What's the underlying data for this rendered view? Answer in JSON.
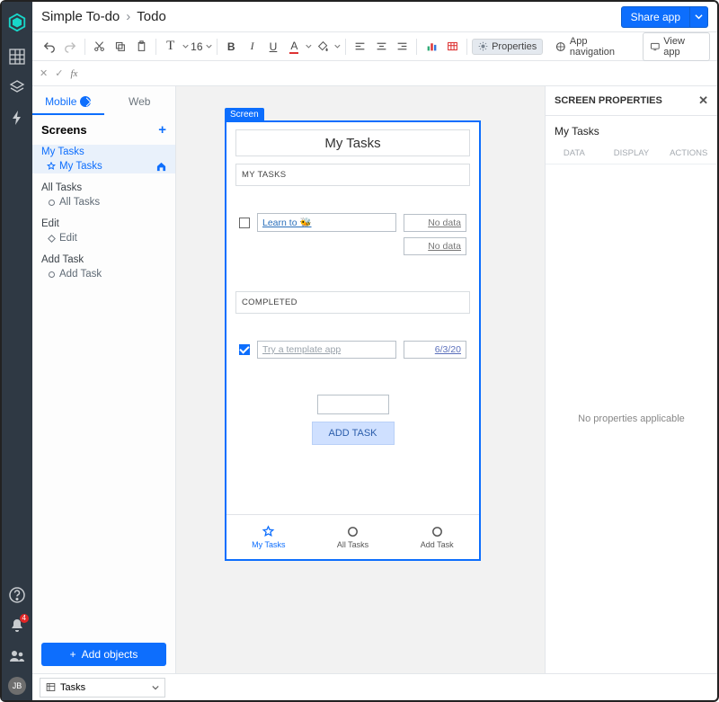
{
  "breadcrumb": {
    "app": "Simple To-do",
    "page": "Todo"
  },
  "topbar": {
    "share": "Share app"
  },
  "toolbar": {
    "font_size": "16",
    "properties": "Properties",
    "app_navigation": "App navigation",
    "view_app": "View app"
  },
  "fx": {
    "label": "fx"
  },
  "sidebar": {
    "tabs": {
      "mobile": "Mobile",
      "web": "Web"
    },
    "heading": "Screens",
    "groups": [
      {
        "title": "My Tasks",
        "sub": "My Tasks",
        "icon": "star",
        "selected": true,
        "home": true
      },
      {
        "title": "All Tasks",
        "sub": "All Tasks",
        "icon": "circle"
      },
      {
        "title": "Edit",
        "sub": "Edit",
        "icon": "tag"
      },
      {
        "title": "Add Task",
        "sub": "Add Task",
        "icon": "circle"
      }
    ],
    "add_objects": "Add objects"
  },
  "canvas": {
    "screen_tag": "Screen",
    "title": "My Tasks",
    "sections": {
      "my_tasks_label": "MY TASKS",
      "completed_label": "COMPLETED"
    },
    "tasks": {
      "open": {
        "text": "Learn to 🐝",
        "right1": "No data",
        "right2": "No data"
      },
      "done": {
        "text": "Try a template app",
        "right": "6/3/20"
      }
    },
    "add_task_btn": "ADD TASK",
    "nav": {
      "my": "My Tasks",
      "all": "All Tasks",
      "add": "Add Task"
    }
  },
  "right_panel": {
    "header": "SCREEN PROPERTIES",
    "title": "My Tasks",
    "tabs": {
      "data": "DATA",
      "display": "DISPLAY",
      "actions": "ACTIONS"
    },
    "empty": "No properties applicable"
  },
  "status": {
    "select": "Tasks"
  },
  "avatar": "JB",
  "badge": "4"
}
